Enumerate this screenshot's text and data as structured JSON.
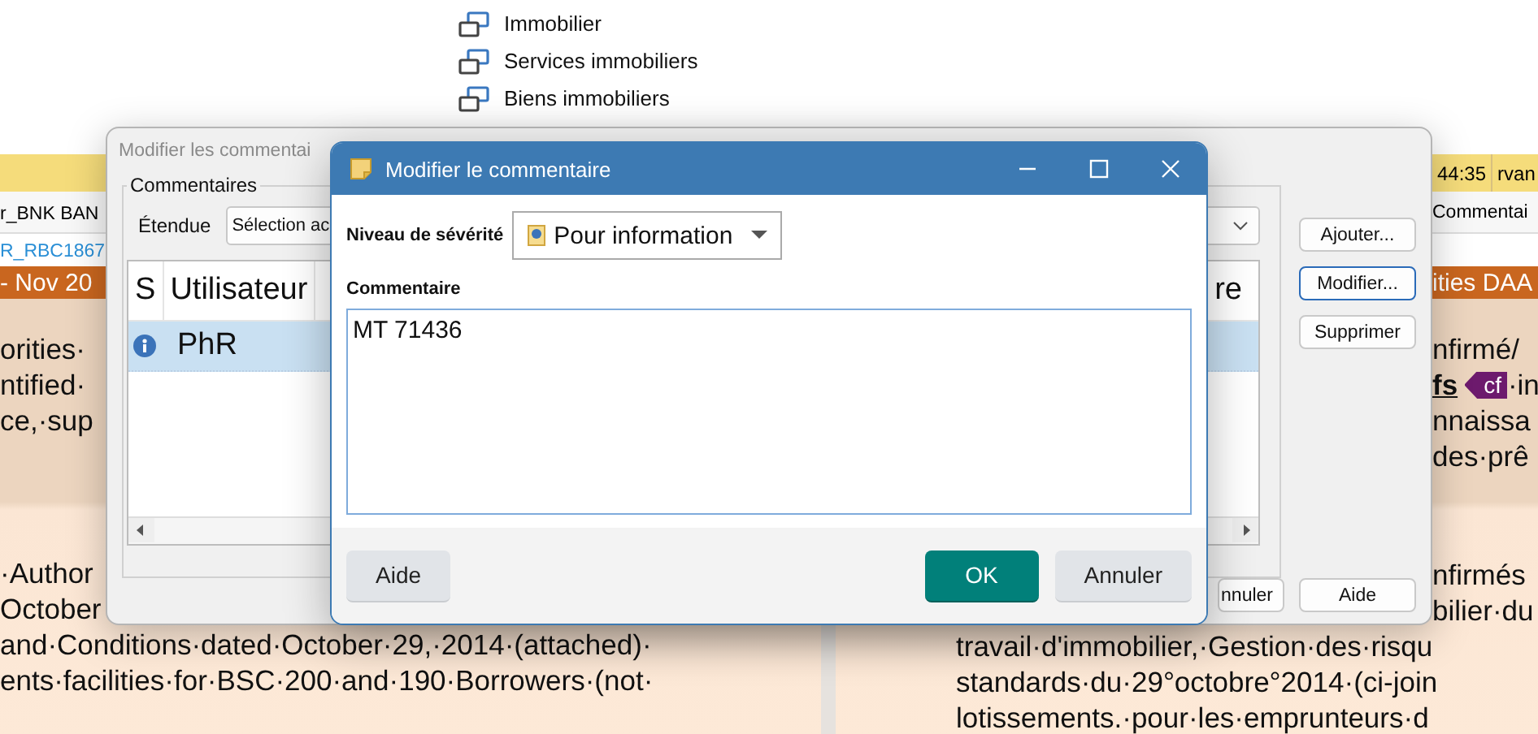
{
  "menu_items": [
    {
      "label": "Immobilier"
    },
    {
      "label": "Services immobiliers"
    },
    {
      "label": "Biens immobiliers"
    }
  ],
  "document": {
    "left": {
      "info_row": "r_BNK BAN",
      "link": "R_RBC1867",
      "section_bar": "- Nov 20",
      "paragraphs": [
        [
          "orities·",
          "ntified·",
          "ce,·sup"
        ],
        [
          "·Author",
          "October",
          "and·Conditions·dated·October·29,·2014·(attached)·",
          "ents·facilities·for·BSC·200·and·190·Borrowers·(not·"
        ]
      ]
    },
    "right": {
      "time": "44:35",
      "user": "rvan",
      "column": "Commentai",
      "section_bar": "ities DAA",
      "paragraphs": [
        [
          {
            "text": "nfirmé/"
          },
          {
            "term": "fs",
            "tag": "cf",
            "text": "·in"
          },
          {
            "text": "nnaissa"
          },
          {
            "text": "des·prê"
          }
        ],
        [
          {
            "text": "nfirmés"
          },
          {
            "text": "bilier·du"
          }
        ]
      ],
      "continued_lines": [
        "travail·d'immobilier,·Gestion·des·risqu",
        "standards·du·29°octobre°2014·(ci-join",
        "lotissements.·pour·les·emprunteurs·d"
      ]
    }
  },
  "parent_dialog": {
    "title": "Modifier les commentai",
    "group": "Commentaires",
    "scope_label": "Étendue",
    "scope_value": "Sélection ac",
    "columns": [
      "S",
      "Utilisateur",
      "re"
    ],
    "rows": [
      {
        "kind": "info",
        "user": "PhR",
        "selected": true
      }
    ],
    "side_buttons": [
      {
        "label": "Ajouter...",
        "focused": false
      },
      {
        "label": "Modifier...",
        "focused": true
      },
      {
        "label": "Supprimer",
        "focused": false
      }
    ],
    "bottom_buttons": [
      "nnuler",
      "Aide"
    ]
  },
  "dialog": {
    "title": "Modifier le commentaire",
    "severity_label": "Niveau de sévérité",
    "severity_value": "Pour information",
    "comment_label": "Commentaire",
    "comment": "MT 71436",
    "buttons": [
      {
        "label": "Aide",
        "kind": "secondary"
      },
      {
        "label": "OK",
        "kind": "primary"
      },
      {
        "label": "Annuler",
        "kind": "secondary"
      }
    ]
  }
}
